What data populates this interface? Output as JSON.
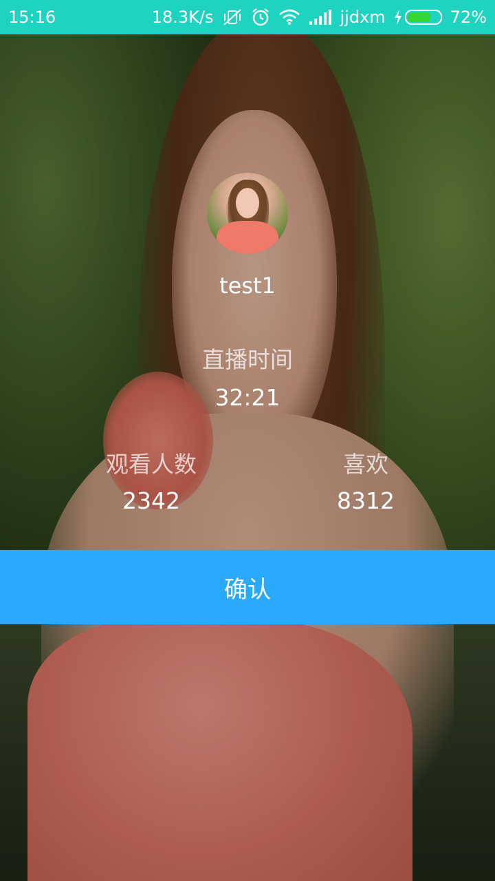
{
  "status_bar": {
    "time": "15:16",
    "net_speed": "18.3K/s",
    "carrier": "jjdxm",
    "battery_percent": "72%",
    "battery_level": 0.72,
    "icons": [
      "mute-vibrate-icon",
      "alarm-icon",
      "wifi-icon",
      "signal-icon",
      "charging-icon",
      "battery-icon"
    ],
    "background_color": "#1fd3c1"
  },
  "profile": {
    "username": "test1"
  },
  "stats": {
    "live_time_label": "直播时间",
    "live_time_value": "32:21",
    "viewers_label": "观看人数",
    "viewers_value": "2342",
    "likes_label": "喜欢",
    "likes_value": "8312"
  },
  "actions": {
    "confirm_label": "确认",
    "confirm_color": "#28a9fb"
  }
}
